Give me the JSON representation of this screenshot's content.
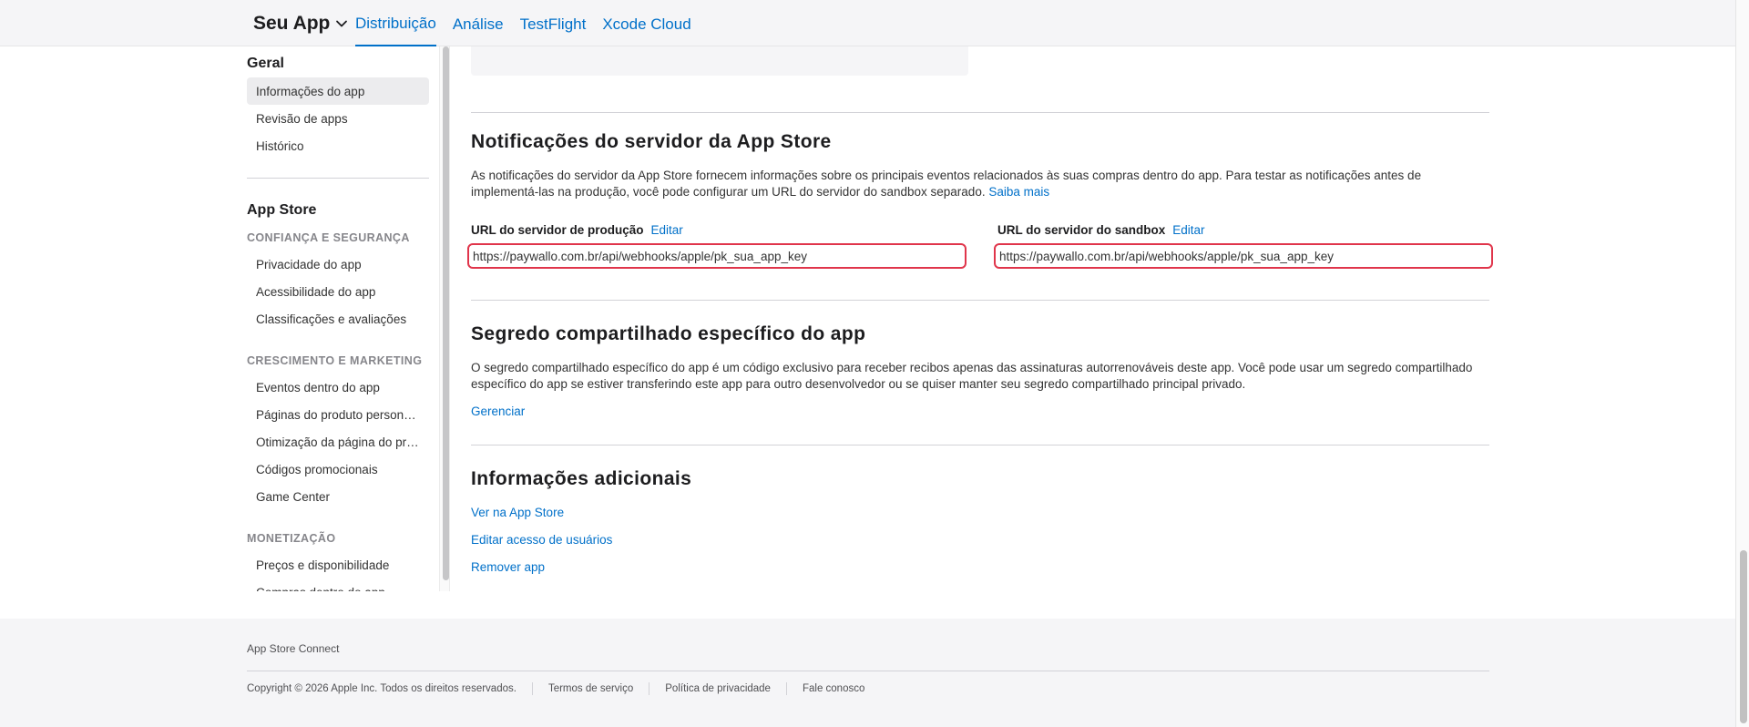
{
  "header": {
    "app_name": "Seu App",
    "tabs": [
      {
        "label": "Distribuição",
        "active": true
      },
      {
        "label": "Análise"
      },
      {
        "label": "TestFlight"
      },
      {
        "label": "Xcode Cloud"
      }
    ]
  },
  "sidebar": {
    "general_heading": "Geral",
    "general_items": [
      "Informações do app",
      "Revisão de apps",
      "Histórico"
    ],
    "appstore_heading": "App Store",
    "trust_category": "CONFIANÇA E SEGURANÇA",
    "trust_items": [
      "Privacidade do app",
      "Acessibilidade do app",
      "Classificações e avaliações"
    ],
    "growth_category": "CRESCIMENTO E MARKETING",
    "growth_items": [
      "Eventos dentro do app",
      "Páginas do produto person…",
      "Otimização da página do pr…",
      "Códigos promocionais",
      "Game Center"
    ],
    "monetization_category": "MONETIZAÇÃO",
    "monetization_items": [
      "Preços e disponibilidade",
      "Compras dentro do app"
    ]
  },
  "notifications": {
    "title": "Notificações do servidor da App Store",
    "description": "As notificações do servidor da App Store fornecem informações sobre os principais eventos relacionados às suas compras dentro do app. Para testar as notificações antes de implementá-las na produção, você pode configurar um URL do servidor do sandbox separado.",
    "learn_more": "Saiba mais",
    "production_label": "URL do servidor de produção",
    "production_edit": "Editar",
    "production_url": "https://paywallo.com.br/api/webhooks/apple/pk_sua_app_key",
    "sandbox_label": "URL do servidor do sandbox",
    "sandbox_edit": "Editar",
    "sandbox_url": "https://paywallo.com.br/api/webhooks/apple/pk_sua_app_key"
  },
  "shared_secret": {
    "title": "Segredo compartilhado específico do app",
    "description": "O segredo compartilhado específico do app é um código exclusivo para receber recibos apenas das assinaturas autorrenováveis deste app. Você pode usar um segredo compartilhado específico do app se estiver transferindo este app para outro desenvolvedor ou se quiser manter seu segredo compartilhado principal privado.",
    "manage_link": "Gerenciar"
  },
  "additional": {
    "title": "Informações adicionais",
    "links": [
      "Ver na App Store",
      "Editar acesso de usuários",
      "Remover app"
    ]
  },
  "footer": {
    "brand": "App Store Connect",
    "copyright": "Copyright © 2026 Apple Inc. Todos os direitos reservados.",
    "links": [
      "Termos de serviço",
      "Política de privacidade",
      "Fale conosco"
    ]
  }
}
